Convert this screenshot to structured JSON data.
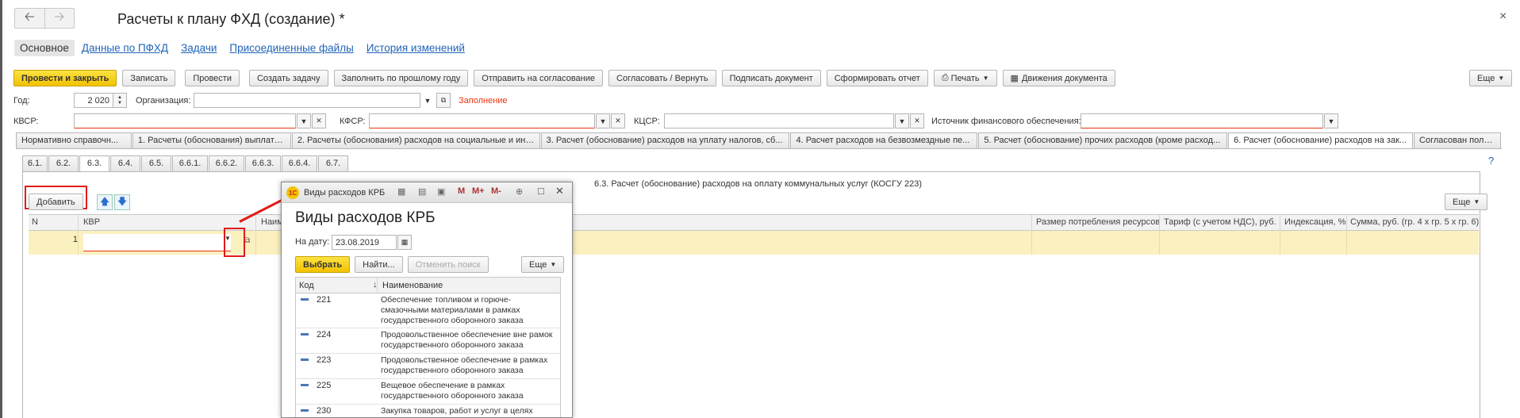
{
  "window": {
    "title": "Расчеты к плану ФХД (создание) *",
    "back_icon": "arrow-left-icon",
    "forward_icon": "arrow-right-icon",
    "close_glyph": "×"
  },
  "section_tabs": [
    {
      "label": "Основное",
      "active": true
    },
    {
      "label": "Данные по ПФХД"
    },
    {
      "label": "Задачи"
    },
    {
      "label": "Присоединенные файлы"
    },
    {
      "label": "История изменений"
    }
  ],
  "toolbar": {
    "post_close": "Провести и закрыть",
    "save": "Записать",
    "post": "Провести",
    "create_task": "Создать задачу",
    "fill_prev_year": "Заполнить по прошлому году",
    "send_approval": "Отправить на согласование",
    "approve_return": "Согласовать / Вернуть",
    "sign": "Подписать документ",
    "report": "Сформировать отчет",
    "print": "Печать",
    "movements": "Движения документа",
    "more": "Еще"
  },
  "header": {
    "year_label": "Год:",
    "year_value": "2 020",
    "org_label": "Организация:",
    "org_value": "",
    "fill_status": "Заполнение",
    "kvsr_label": "КВСР:",
    "kfsr_label": "КФСР:",
    "kcsr_label": "КЦСР:",
    "source_label": "Источник финансового обеспечения:"
  },
  "doc_tabs": [
    {
      "label": "Нормативно справочн..."
    },
    {
      "label": "1. Расчеты (обоснования) выплат п..."
    },
    {
      "label": "2. Расчеты (обоснования) расходов на социальные и ины..."
    },
    {
      "label": "3. Расчет (обоснование) расходов на уплату налогов, сб..."
    },
    {
      "label": "4. Расчет расходов на безвозмездные пе..."
    },
    {
      "label": "5. Расчет (обоснование) прочих расходов (кроме расход..."
    },
    {
      "label": "6. Расчет (обоснование) расходов на зак...",
      "active": true
    },
    {
      "label": "Согласован поль..."
    }
  ],
  "sub_tabs": [
    {
      "label": "6.1."
    },
    {
      "label": "6.2."
    },
    {
      "label": "6.3.",
      "active": true
    },
    {
      "label": "6.4."
    },
    {
      "label": "6.5."
    },
    {
      "label": "6.6.1."
    },
    {
      "label": "6.6.2."
    },
    {
      "label": "6.6.3."
    },
    {
      "label": "6.6.4."
    },
    {
      "label": "6.7."
    }
  ],
  "panel": {
    "title": "6.3. Расчет (обоснование) расходов на оплату коммунальных услуг (КОСГУ 223)",
    "add": "Добавить",
    "more": "Еще",
    "help": "?",
    "columns": [
      "N",
      "КВР",
      "Наим",
      "Размер потребления ресурсов",
      "Тариф (с учетом НДС), руб.",
      "Индексация, %",
      "Сумма, руб. (гр. 4 х гр. 5 х гр. 6)"
    ],
    "rows": [
      {
        "n": "1",
        "kvr": ""
      }
    ]
  },
  "modal": {
    "bar_title": "Виды расходов КРБ",
    "title": "Виды расходов КРБ",
    "date_label": "На дату:",
    "date_value": "23.08.2019",
    "select": "Выбрать",
    "find": "Найти...",
    "cancel_search": "Отменить поиск",
    "more": "Еще",
    "col_code": "Код",
    "col_name": "Наименование",
    "sort_glyph": "↓",
    "rows": [
      {
        "code": "221",
        "name": "Обеспечение топливом и горюче-смазочными материалами в рамках государственного оборонного заказа"
      },
      {
        "code": "224",
        "name": "Продовольственное обеспечение вне рамок государственного оборонного заказа"
      },
      {
        "code": "223",
        "name": "Продовольственное обеспечение в рамках государственного оборонного заказа"
      },
      {
        "code": "225",
        "name": "Вещевое обеспечение в рамках государственного оборонного заказа"
      },
      {
        "code": "230",
        "name": "Закупка товаров, работ и услуг в целях"
      }
    ]
  },
  "colors": {
    "accent_yellow": "#f2c200",
    "link_blue": "#2264b8",
    "required_red": "#e31b1b",
    "row_highlight": "#fbf0bf"
  }
}
